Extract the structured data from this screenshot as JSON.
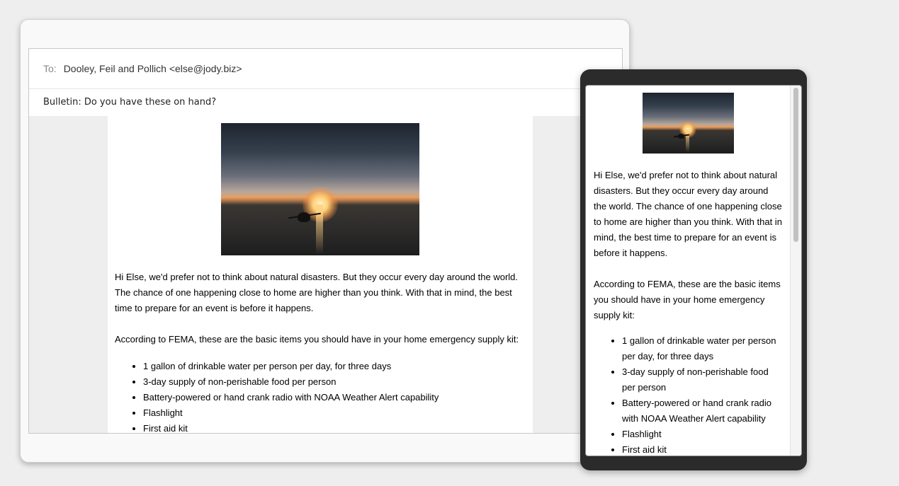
{
  "email": {
    "to_label": "To:",
    "to_value": "Dooley, Feil and Pollich <else@jody.biz>",
    "subject": "Bulletin: Do you have these on hand?",
    "hero_image": "sunset-kayak-photo",
    "paragraph1": "Hi Else, we'd prefer not to think about natural disasters. But they occur every day around the world. The chance of one happening close to home are higher than you think. With that in mind, the best time to prepare for an event is before it happens.",
    "paragraph2": "According to FEMA, these are the basic items you should have in your home emergency supply kit:",
    "items": [
      "1 gallon of drinkable water per person per day, for three days",
      "3-day supply of non-perishable food per person",
      "Battery-powered or hand crank radio with NOAA Weather Alert capability",
      "Flashlight",
      "First aid kit"
    ]
  },
  "colors": {
    "page_background": "#eeeeee",
    "mobile_frame": "#2b2b2b",
    "text": "#000000",
    "label": "#888888"
  }
}
